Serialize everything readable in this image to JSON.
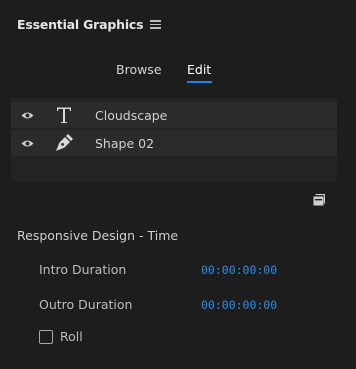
{
  "panel": {
    "title": "Essential Graphics",
    "menu_icon": "hamburger-menu-icon"
  },
  "tabs": [
    {
      "label": "Browse",
      "active": false
    },
    {
      "label": "Edit",
      "active": true
    }
  ],
  "accent_color": "#2680eb",
  "layers": [
    {
      "name": "Cloudscape",
      "type_icon": "text-layer-icon",
      "visible": true
    },
    {
      "name": "Shape 02",
      "type_icon": "pen-shape-icon",
      "visible": true
    }
  ],
  "new_layer_icon": "new-layer-icon",
  "responsive_design": {
    "title": "Responsive Design - Time",
    "intro_label": "Intro Duration",
    "intro_value": "00:00:00:00",
    "outro_label": "Outro Duration",
    "outro_value": "00:00:00:00",
    "roll_label": "Roll",
    "roll_checked": false
  }
}
